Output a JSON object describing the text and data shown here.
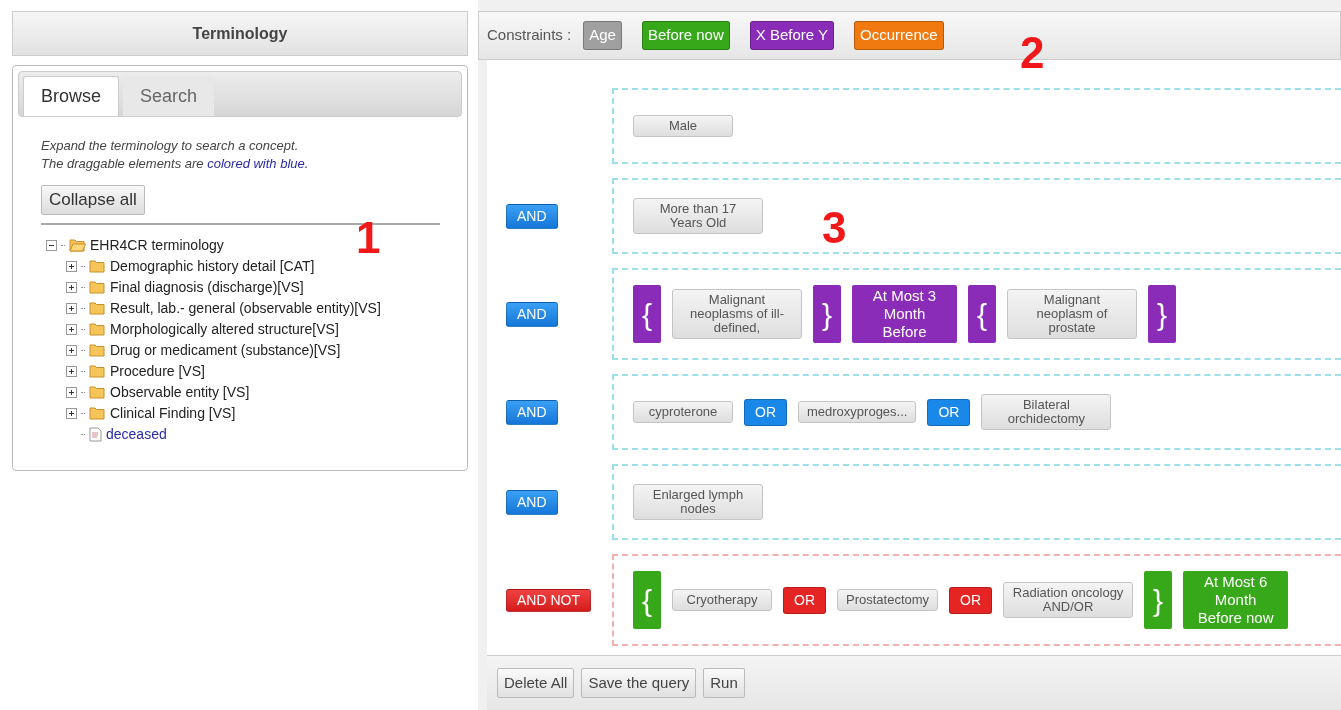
{
  "terminology": {
    "title": "Terminology",
    "tabs": [
      {
        "label": "Browse",
        "selected": true
      },
      {
        "label": "Search",
        "selected": false
      }
    ],
    "hint": {
      "line_1": "Expand the terminology to search a concept.",
      "line_2_start": "The draggable elements are",
      "line_2_highlight": "colored with blue."
    },
    "collapse_button": "Collapse all",
    "tree": {
      "label": "EHR4CR terminology",
      "kind": "folder",
      "expanded": true,
      "children": [
        {
          "label": "Demographic history detail [CAT]",
          "kind": "folder",
          "expanded": false
        },
        {
          "label": "Final diagnosis (discharge)[VS]",
          "kind": "folder",
          "expanded": false
        },
        {
          "label": "Result, lab.- general (observable entity)[VS]",
          "kind": "folder",
          "expanded": false
        },
        {
          "label": "Morphologically altered structure[VS]",
          "kind": "folder",
          "expanded": false
        },
        {
          "label": "Drug or medicament (substance)[VS]",
          "kind": "folder",
          "expanded": false
        },
        {
          "label": "Procedure [VS]",
          "kind": "folder",
          "expanded": false
        },
        {
          "label": "Observable entity [VS]",
          "kind": "folder",
          "expanded": false
        },
        {
          "label": "Clinical Finding [VS]",
          "kind": "folder",
          "expanded": false
        },
        {
          "label": "deceased",
          "kind": "concept"
        }
      ]
    }
  },
  "constraints": {
    "label": "Constraints :",
    "items": [
      {
        "label": "Age",
        "color": "#a0a0a0"
      },
      {
        "label": "Before now",
        "color": "#36a81a"
      },
      {
        "label": "X Before Y",
        "color": "#8a2cb8"
      },
      {
        "label": "Occurrence",
        "color": "#f07a10"
      }
    ]
  },
  "query": {
    "rows": [
      {
        "items": [
          {
            "kind": "concept",
            "label": "Male"
          }
        ]
      },
      {
        "operator": {
          "kind": "and",
          "label": "AND"
        },
        "items": [
          {
            "kind": "concept",
            "label": "More than 17 Years Old"
          }
        ]
      },
      {
        "operator": {
          "kind": "and",
          "label": "AND"
        },
        "items": [
          {
            "kind": "brace_open",
            "label": "{",
            "color": "#8a2cb8"
          },
          {
            "kind": "concept",
            "label": "Malignant neoplasms of ill-defined,"
          },
          {
            "kind": "brace_close",
            "label": "}",
            "color": "#8a2cb8"
          },
          {
            "kind": "constraint",
            "label": "At Most 3 Month Before",
            "color": "#8a2cb8"
          },
          {
            "kind": "brace_open",
            "label": "{",
            "color": "#8a2cb8"
          },
          {
            "kind": "concept",
            "label": "Malignant neoplasm of prostate"
          },
          {
            "kind": "brace_close",
            "label": "}",
            "color": "#8a2cb8"
          }
        ]
      },
      {
        "operator": {
          "kind": "and",
          "label": "AND"
        },
        "items": [
          {
            "kind": "concept",
            "label": "cyproterone"
          },
          {
            "kind": "or",
            "label": "OR",
            "color": "#1a88e8"
          },
          {
            "kind": "concept",
            "label": "medroxyproges..."
          },
          {
            "kind": "or",
            "label": "OR",
            "color": "#1a88e8"
          },
          {
            "kind": "concept",
            "label": "Bilateral orchidectomy"
          }
        ]
      },
      {
        "operator": {
          "kind": "and",
          "label": "AND"
        },
        "items": [
          {
            "kind": "concept",
            "label": "Enlarged lymph nodes"
          }
        ]
      },
      {
        "operator": {
          "kind": "and_not",
          "label": "AND NOT"
        },
        "items": [
          {
            "kind": "brace_open",
            "label": "{",
            "color": "#36a81a"
          },
          {
            "kind": "concept",
            "label": "Cryotherapy"
          },
          {
            "kind": "or",
            "label": "OR",
            "color": "#e52424"
          },
          {
            "kind": "concept",
            "label": "Prostatectomy"
          },
          {
            "kind": "or",
            "label": "OR",
            "color": "#e52424"
          },
          {
            "kind": "concept",
            "label": "Radiation oncology AND/OR"
          },
          {
            "kind": "brace_close",
            "label": "}",
            "color": "#36a81a"
          },
          {
            "kind": "constraint",
            "label": "At Most 6 Month Before now",
            "color": "#36a81a"
          }
        ]
      }
    ]
  },
  "footer_buttons": [
    "Delete All",
    "Save the query",
    "Run"
  ],
  "annotations": {
    "terminology_marker": "1",
    "constraints_marker": "2",
    "query_marker": "3"
  }
}
